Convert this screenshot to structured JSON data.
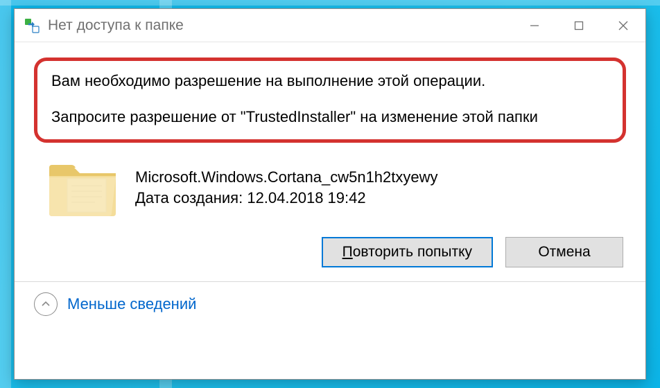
{
  "dialog": {
    "title": "Нет доступа к папке",
    "message_line1": "Вам необходимо разрешение на выполнение этой операции.",
    "message_line2": "Запросите разрешение от \"TrustedInstaller\" на изменение этой папки",
    "folder": {
      "name": "Microsoft.Windows.Cortana_cw5n1h2txyewy",
      "date_label": "Дата создания:",
      "date_value": "12.04.2018 19:42"
    },
    "buttons": {
      "retry_prefix": "П",
      "retry_rest": "овторить попытку",
      "cancel": "Отмена"
    },
    "footer": {
      "less_details": "Меньше сведений"
    }
  }
}
